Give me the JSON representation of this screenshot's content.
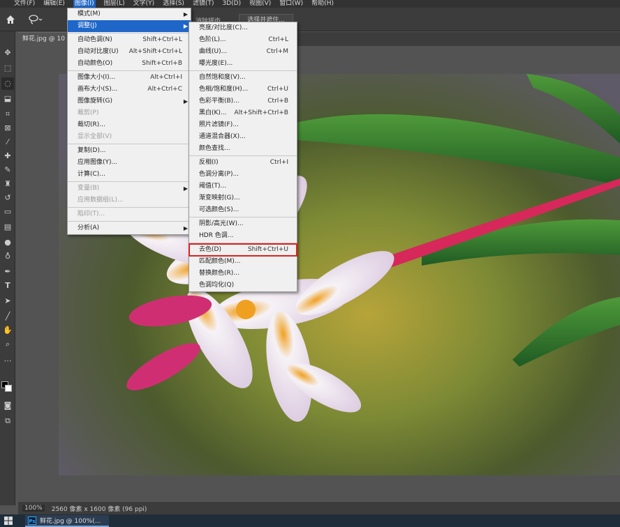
{
  "menubar": {
    "items": [
      "文件(F)",
      "编辑(E)",
      "图像(I)",
      "图层(L)",
      "文字(Y)",
      "选择(S)",
      "滤镜(T)",
      "3D(D)",
      "视图(V)",
      "窗口(W)",
      "帮助(H)"
    ]
  },
  "options": {
    "partial_text": "消除锯齿",
    "select_mask_button": "选择并遮住..."
  },
  "document": {
    "tab_title": "鲜花.jpg @ 10"
  },
  "status": {
    "zoom": "100%",
    "info": "2560 像素 x 1600 像素 (96 ppi)"
  },
  "taskbar": {
    "ps_label": "鲜花.jpg @ 100%(..."
  },
  "image_menu": {
    "groups": [
      [
        {
          "label": "模式(M)",
          "submenu": true
        },
        {
          "label": "调整(J)",
          "submenu": true,
          "highlight": true
        }
      ],
      [
        {
          "label": "自动色调(N)",
          "shortcut": "Shift+Ctrl+L"
        },
        {
          "label": "自动对比度(U)",
          "shortcut": "Alt+Shift+Ctrl+L"
        },
        {
          "label": "自动颜色(O)",
          "shortcut": "Shift+Ctrl+B"
        }
      ],
      [
        {
          "label": "图像大小(I)...",
          "shortcut": "Alt+Ctrl+I"
        },
        {
          "label": "画布大小(S)...",
          "shortcut": "Alt+Ctrl+C"
        },
        {
          "label": "图像旋转(G)",
          "submenu": true
        },
        {
          "label": "裁剪(P)",
          "disabled": true
        },
        {
          "label": "裁切(R)..."
        },
        {
          "label": "显示全部(V)",
          "disabled": true
        }
      ],
      [
        {
          "label": "复制(D)..."
        },
        {
          "label": "应用图像(Y)..."
        },
        {
          "label": "计算(C)..."
        }
      ],
      [
        {
          "label": "变量(B)",
          "submenu": true,
          "disabled": true
        },
        {
          "label": "应用数据组(L)...",
          "disabled": true
        }
      ],
      [
        {
          "label": "陷印(T)...",
          "disabled": true
        }
      ],
      [
        {
          "label": "分析(A)",
          "submenu": true
        }
      ]
    ]
  },
  "adjust_menu": {
    "groups": [
      [
        {
          "label": "亮度/对比度(C)..."
        },
        {
          "label": "色阶(L)...",
          "shortcut": "Ctrl+L"
        },
        {
          "label": "曲线(U)...",
          "shortcut": "Ctrl+M"
        },
        {
          "label": "曝光度(E)..."
        }
      ],
      [
        {
          "label": "自然饱和度(V)..."
        },
        {
          "label": "色相/饱和度(H)...",
          "shortcut": "Ctrl+U"
        },
        {
          "label": "色彩平衡(B)...",
          "shortcut": "Ctrl+B"
        },
        {
          "label": "黑白(K)...",
          "shortcut": "Alt+Shift+Ctrl+B"
        },
        {
          "label": "照片滤镜(F)..."
        },
        {
          "label": "通道混合器(X)..."
        },
        {
          "label": "颜色查找..."
        }
      ],
      [
        {
          "label": "反相(I)",
          "shortcut": "Ctrl+I"
        },
        {
          "label": "色调分离(P)..."
        },
        {
          "label": "阈值(T)..."
        },
        {
          "label": "渐变映射(G)..."
        },
        {
          "label": "可选颜色(S)..."
        }
      ],
      [
        {
          "label": "阴影/高光(W)..."
        },
        {
          "label": "HDR 色调..."
        }
      ],
      [
        {
          "label": "去色(D)",
          "shortcut": "Shift+Ctrl+U",
          "boxed": true
        },
        {
          "label": "匹配颜色(M)..."
        },
        {
          "label": "替换颜色(R)..."
        },
        {
          "label": "色调均化(Q)"
        }
      ]
    ]
  },
  "icons": [
    "home-icon",
    "lasso-icon",
    "move-icon",
    "marquee-icon",
    "crop-icon",
    "eyedropper-icon",
    "brush-icon",
    "type-icon",
    "hand-icon",
    "zoom-icon"
  ],
  "colors": {
    "highlight": "#1e66c8",
    "box": "#e02020",
    "menu_bg": "#f0f0f0"
  }
}
